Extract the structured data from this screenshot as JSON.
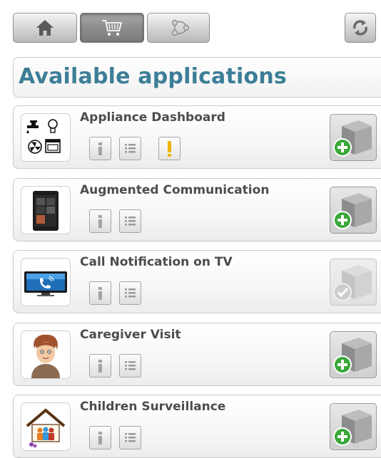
{
  "toolbar": {
    "buttons": [
      {
        "icon": "home-icon",
        "active": false
      },
      {
        "icon": "cart-icon",
        "active": true
      },
      {
        "icon": "network-icon",
        "active": false
      },
      {
        "icon": "refresh-icon",
        "active": false
      }
    ]
  },
  "header": {
    "title": "Available applications"
  },
  "apps": [
    {
      "name": "Appliance Dashboard",
      "icon": "appliance-dashboard-icon",
      "has_warning": true,
      "status": "add"
    },
    {
      "name": "Augmented Communication",
      "icon": "augmented-communication-icon",
      "has_warning": false,
      "status": "add"
    },
    {
      "name": "Call Notification on TV",
      "icon": "call-notification-tv-icon",
      "has_warning": false,
      "status": "installed"
    },
    {
      "name": "Caregiver Visit",
      "icon": "caregiver-visit-icon",
      "has_warning": false,
      "status": "add"
    },
    {
      "name": "Children Surveillance",
      "icon": "children-surveillance-icon",
      "has_warning": false,
      "status": "add"
    }
  ],
  "colors": {
    "title": "#3d7e97",
    "app_name": "#4d4d4d",
    "add_green": "#3aa83a",
    "warning": "#f0b400"
  }
}
